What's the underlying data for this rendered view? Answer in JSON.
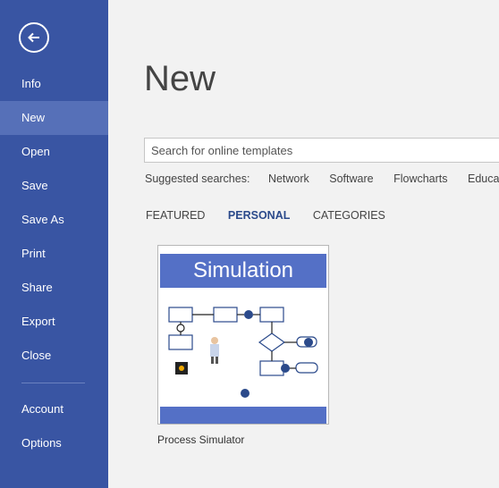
{
  "sidebar": {
    "items": [
      {
        "label": "Info"
      },
      {
        "label": "New"
      },
      {
        "label": "Open"
      },
      {
        "label": "Save"
      },
      {
        "label": "Save As"
      },
      {
        "label": "Print"
      },
      {
        "label": "Share"
      },
      {
        "label": "Export"
      },
      {
        "label": "Close"
      },
      {
        "label": "Account"
      },
      {
        "label": "Options"
      }
    ],
    "active": "New",
    "bg_color": "#3955a3",
    "active_color": "#5670b8"
  },
  "main": {
    "title": "New",
    "search": {
      "placeholder": "Search for online templates"
    },
    "suggested": {
      "label": "Suggested searches:",
      "links": [
        "Network",
        "Software",
        "Flowcharts",
        "Education"
      ]
    },
    "tabs": [
      {
        "label": "FEATURED"
      },
      {
        "label": "PERSONAL"
      },
      {
        "label": "CATEGORIES"
      }
    ],
    "active_tab": "PERSONAL",
    "accent_color": "#2b4a8b",
    "templates": [
      {
        "name": "Process Simulator",
        "thumbnail_title": "Simulation"
      }
    ]
  }
}
